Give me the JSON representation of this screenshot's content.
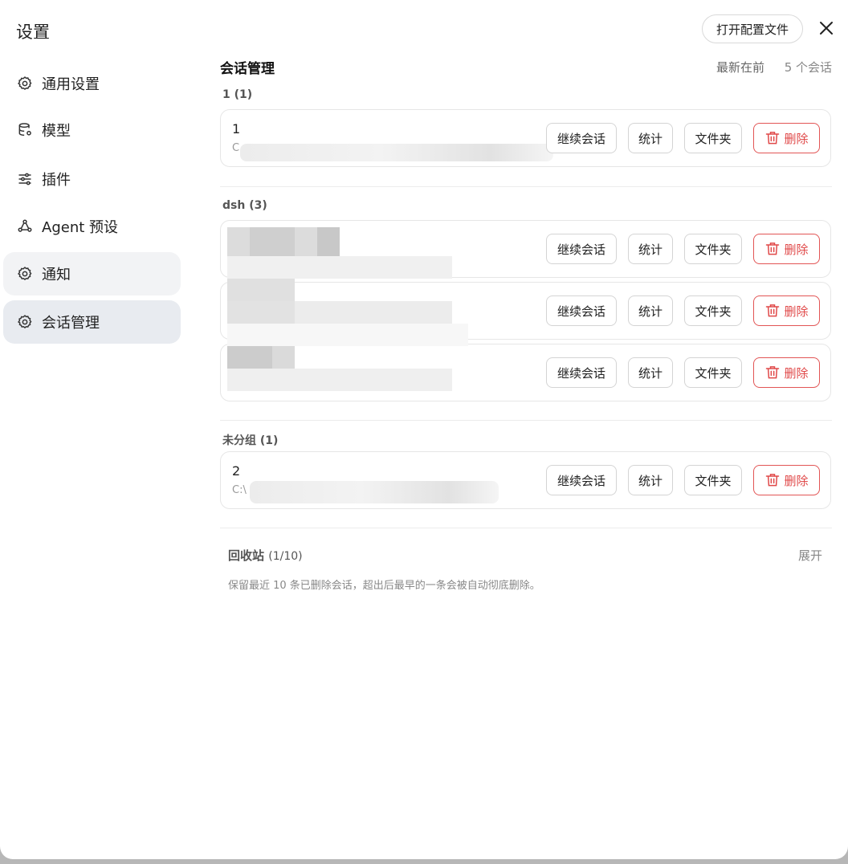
{
  "sidebar": {
    "title": "设置",
    "items": [
      {
        "label": "通用设置",
        "icon": "gear-icon"
      },
      {
        "label": "模型",
        "icon": "database-icon"
      },
      {
        "label": "插件",
        "icon": "sliders-icon"
      },
      {
        "label": "Agent 预设",
        "icon": "agent-icon"
      },
      {
        "label": "通知",
        "icon": "gear-icon"
      },
      {
        "label": "会话管理",
        "icon": "gear-icon"
      }
    ]
  },
  "header": {
    "open_config_label": "打开配置文件",
    "close_icon": "close-icon"
  },
  "main": {
    "title": "会话管理",
    "sort_label": "最新在前",
    "count_label": "5 个会话",
    "actions": {
      "continue": "继续会话",
      "stats": "统计",
      "folder": "文件夹",
      "delete": "删除"
    },
    "groups": [
      {
        "title": "1 (1)",
        "sessions": [
          {
            "name": "1",
            "path": "C"
          }
        ]
      },
      {
        "title": "dsh (3)",
        "sessions": [
          {
            "name": "",
            "path": ""
          },
          {
            "name": "",
            "path": ""
          },
          {
            "name": "",
            "path": ""
          }
        ]
      },
      {
        "title": "未分组 (1)",
        "sessions": [
          {
            "name": "2",
            "path": "C:\\"
          }
        ]
      }
    ]
  },
  "recycle": {
    "title": "回收站",
    "count": "(1/10)",
    "expand_label": "展开",
    "note": "保留最近 10 条已删除会话，超出后最早的一条会被自动彻底删除。"
  },
  "colors": {
    "active_nav": "#e8ebf0",
    "delete_red": "#e04848"
  }
}
